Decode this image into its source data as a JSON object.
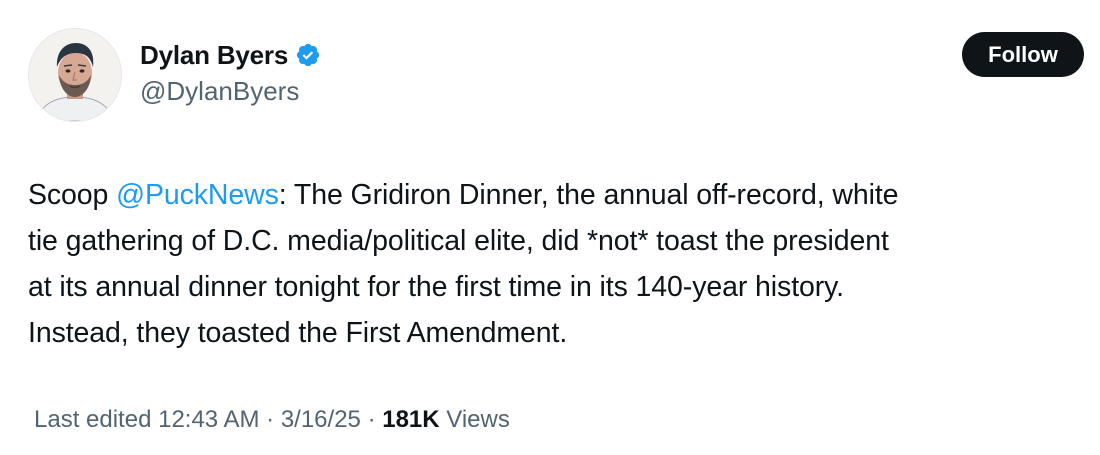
{
  "author": {
    "display_name": "Dylan Byers",
    "handle": "@DylanByers",
    "verified": true,
    "avatar_icon": "portrait-avatar"
  },
  "follow_button": {
    "label": "Follow"
  },
  "tweet": {
    "segments": {
      "prefix": "Scoop ",
      "mention": "@PuckNews",
      "line1_rest": ": The Gridiron Dinner, the annual off-record, white",
      "line2": "tie gathering of D.C. media/political elite, did *not* toast the president",
      "line3": "at its annual dinner tonight for the first time in its 140-year history.",
      "line4": "Instead, they toasted the First Amendment."
    }
  },
  "meta": {
    "edited_label": "Last edited 12:43 AM · 3/16/25",
    "separator": " · ",
    "views_count": "181K",
    "views_label": " Views"
  },
  "colors": {
    "text": "#0f1419",
    "secondary": "#536471",
    "accent": "#1d9bf0",
    "button_bg": "#0f1419"
  }
}
